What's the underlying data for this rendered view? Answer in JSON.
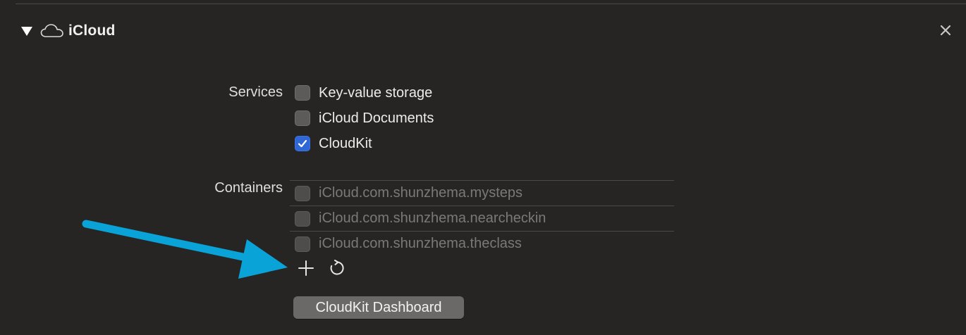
{
  "section": {
    "title": "iCloud",
    "icon": "cloud-icon",
    "expanded": true
  },
  "services": {
    "label": "Services",
    "items": [
      {
        "label": "Key-value storage",
        "checked": false
      },
      {
        "label": "iCloud Documents",
        "checked": false
      },
      {
        "label": "CloudKit",
        "checked": true
      }
    ]
  },
  "containers": {
    "label": "Containers",
    "items": [
      {
        "label": "iCloud.com.shunzhema.mysteps",
        "checked": false
      },
      {
        "label": "iCloud.com.shunzhema.nearcheckin",
        "checked": false
      },
      {
        "label": "iCloud.com.shunzhema.theclass",
        "checked": false
      }
    ],
    "actions": {
      "add_icon": "plus-icon",
      "refresh_icon": "refresh-icon"
    }
  },
  "dashboard_button": {
    "label": "CloudKit Dashboard"
  },
  "colors": {
    "background": "#262524",
    "checkbox_checked": "#2f67d6",
    "annotation_arrow": "#0aa3d8"
  }
}
